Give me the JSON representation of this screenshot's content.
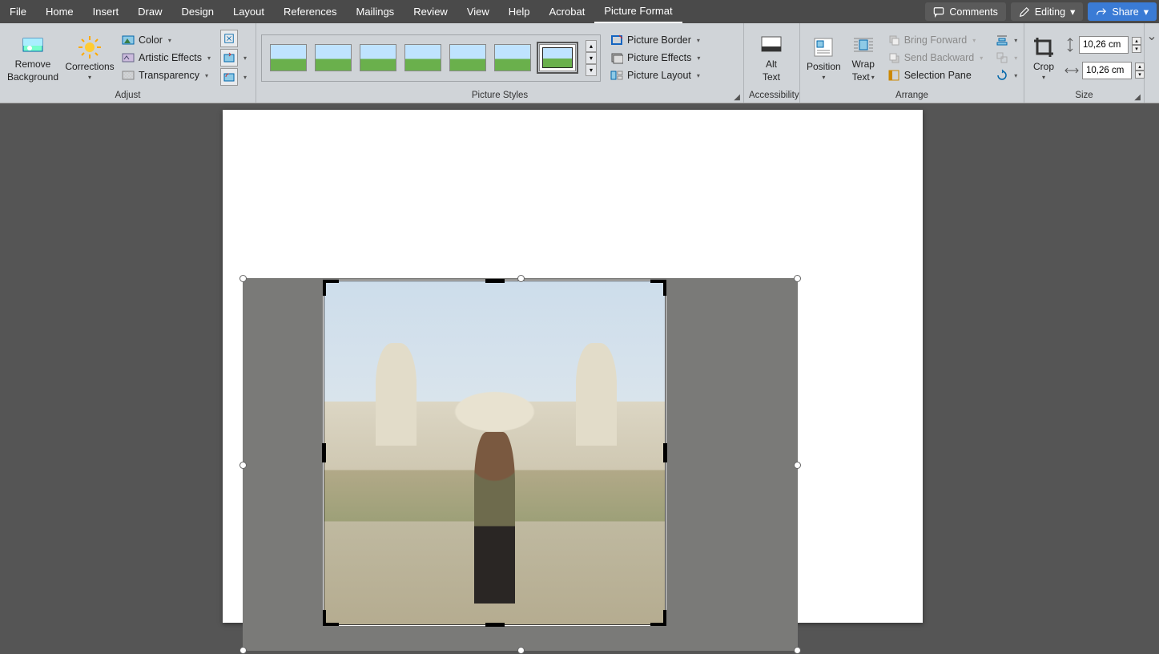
{
  "menu": {
    "tabs": [
      "File",
      "Home",
      "Insert",
      "Draw",
      "Design",
      "Layout",
      "References",
      "Mailings",
      "Review",
      "View",
      "Help",
      "Acrobat",
      "Picture Format"
    ],
    "active_tab": "Picture Format",
    "comments": "Comments",
    "editing": "Editing",
    "share": "Share"
  },
  "ribbon": {
    "adjust": {
      "label": "Adjust",
      "remove_bg_1": "Remove",
      "remove_bg_2": "Background",
      "corrections": "Corrections",
      "color": "Color",
      "artistic": "Artistic Effects",
      "transparency": "Transparency"
    },
    "styles": {
      "label": "Picture Styles",
      "border": "Picture Border",
      "effects": "Picture Effects",
      "layout": "Picture Layout"
    },
    "accessibility": {
      "label": "Accessibility",
      "alt_1": "Alt",
      "alt_2": "Text"
    },
    "arrange": {
      "label": "Arrange",
      "position": "Position",
      "wrap_1": "Wrap",
      "wrap_2": "Text",
      "bring_fwd": "Bring Forward",
      "send_back": "Send Backward",
      "sel_pane": "Selection Pane"
    },
    "size": {
      "label": "Size",
      "crop": "Crop",
      "height": "10,26 cm",
      "width": "10,26 cm"
    }
  }
}
